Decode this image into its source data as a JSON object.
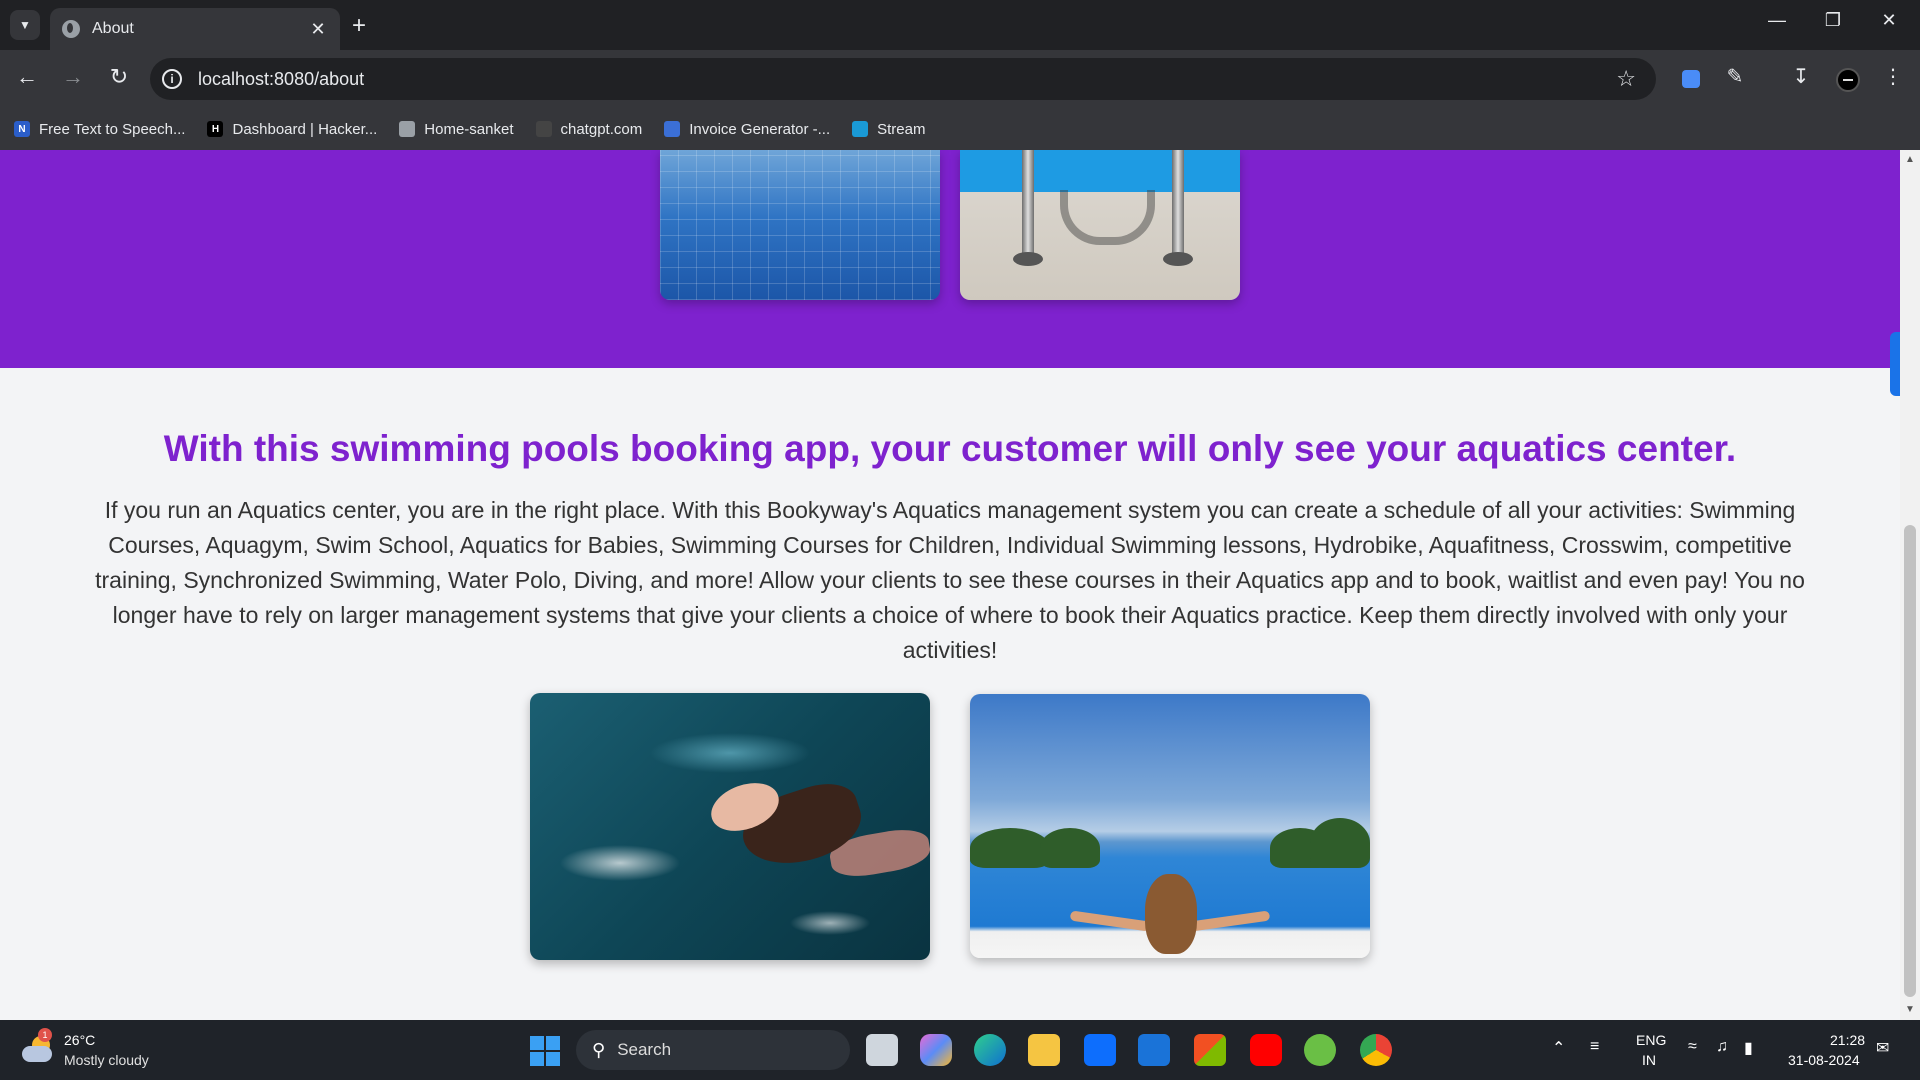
{
  "browser": {
    "tab_title": "About",
    "url": "localhost:8080/about",
    "bookmarks": [
      {
        "label": "Free Text to Speech...",
        "icon": "N",
        "color": "#2b5ec9"
      },
      {
        "label": "Dashboard | Hacker...",
        "icon": "H",
        "color": "#000000"
      },
      {
        "label": "Home-sanket",
        "icon": "",
        "color": "#9aa0a6"
      },
      {
        "label": "chatgpt.com",
        "icon": "",
        "color": "#444444"
      },
      {
        "label": "Invoice Generator -...",
        "icon": "",
        "color": "#3b6fd6"
      },
      {
        "label": "Stream",
        "icon": "",
        "color": "#1a9ad6"
      }
    ]
  },
  "page": {
    "headline": "With this swimming pools booking app, your customer will only see your aquatics center.",
    "body": "If you run an Aquatics center, you are in the right place. With this Bookyway's Aquatics management system you can create a schedule of all your activities: Swimming Courses, Aquagym, Swim School, Aquatics for Babies, Swimming Courses for Children, Individual Swimming lessons, Hydrobike, Aquafitness, Crosswim, competitive training, Synchronized Swimming, Water Polo, Diving, and more! Allow your clients to see these courses in their Aquatics app and to book, waitlist and even pay! You no longer have to rely on larger management systems that give your clients a choice of where to book their Aquatics practice. Keep them directly involved with only your activities!",
    "accent_color": "#7e22ce"
  },
  "taskbar": {
    "weather_temp": "26°C",
    "weather_cond": "Mostly cloudy",
    "weather_badge": "1",
    "search_label": "Search",
    "lang_top": "ENG",
    "lang_bottom": "IN",
    "time": "21:28",
    "date": "31-08-2024"
  }
}
